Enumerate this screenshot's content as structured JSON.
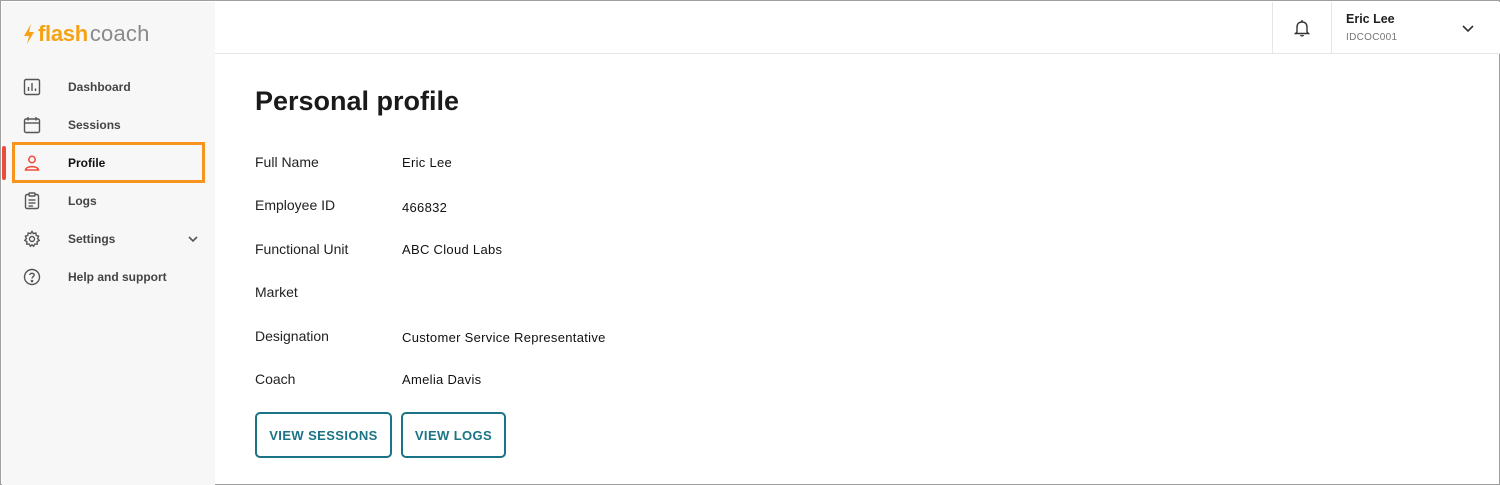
{
  "app": {
    "logo_flash": "flash",
    "logo_coach": "coach",
    "brand_color": "#f5a214"
  },
  "sidebar": {
    "items": [
      {
        "label": "Dashboard",
        "icon": "chart-icon"
      },
      {
        "label": "Sessions",
        "icon": "calendar-icon"
      },
      {
        "label": "Profile",
        "icon": "person-icon",
        "active": true
      },
      {
        "label": "Logs",
        "icon": "clipboard-icon"
      },
      {
        "label": "Settings",
        "icon": "gear-icon",
        "expandable": true
      },
      {
        "label": "Help and support",
        "icon": "help-icon"
      }
    ],
    "active_color": "#ef4b3b"
  },
  "header": {
    "user_name": "Eric Lee",
    "user_id": "IDCOC001"
  },
  "main": {
    "title": "Personal profile",
    "fields": [
      {
        "label": "Full Name",
        "value": "Eric Lee"
      },
      {
        "label": "Employee ID",
        "value": "466832"
      },
      {
        "label": "Functional Unit",
        "value": "ABC Cloud Labs"
      },
      {
        "label": "Market",
        "value": ""
      },
      {
        "label": "Designation",
        "value": "Customer Service Representative"
      },
      {
        "label": "Coach",
        "value": "Amelia Davis"
      }
    ],
    "buttons": {
      "view_sessions": "VIEW SESSIONS",
      "view_logs": "VIEW LOGS"
    },
    "accent_color": "#1b7485"
  }
}
